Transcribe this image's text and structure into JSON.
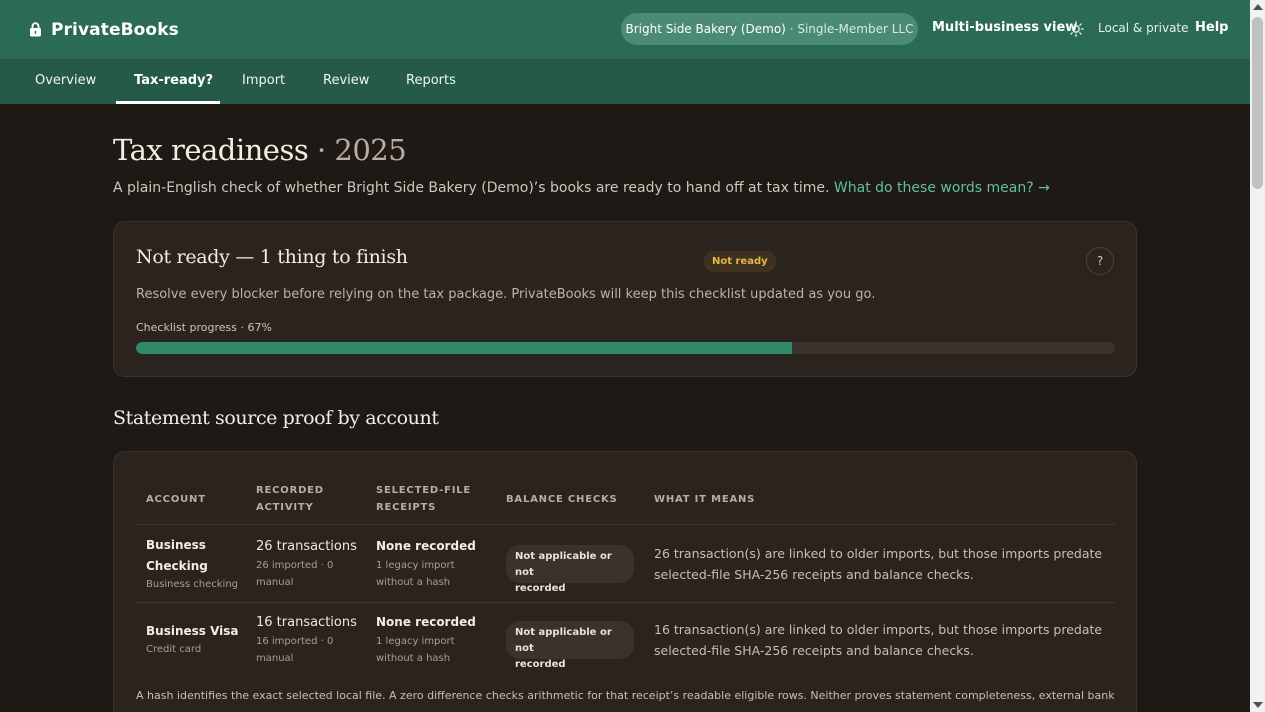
{
  "app": {
    "brand": "PrivateBooks",
    "business_name": "Bright Side Bakery (Demo)",
    "business_type": "· Single-Member LLC",
    "multi_business": "Multi-business view",
    "privacy": "Local & private",
    "help": "Help"
  },
  "nav": {
    "tabs": [
      {
        "label": "Overview"
      },
      {
        "label": "Tax-ready?"
      },
      {
        "label": "Import"
      },
      {
        "label": "Review"
      },
      {
        "label": "Reports"
      }
    ],
    "active": "Tax-ready?"
  },
  "page": {
    "title": "Tax readiness",
    "year": "· 2025",
    "intro": "A plain-English check of whether Bright Side Bakery (Demo)’s books are ready to hand off at tax time.",
    "intro_link": "What do these words mean? →"
  },
  "status": {
    "title": "Not ready — 1 thing to finish",
    "badge": "Not ready",
    "help_button": "?",
    "description": "Resolve every blocker before relying on the tax package. PrivateBooks will keep this checklist updated as you go.",
    "progress_label": "Checklist progress · 67%",
    "progress_fraction": 0.67
  },
  "proof": {
    "title": "Statement source proof by account",
    "columns": {
      "account": "ACCOUNT",
      "activity_1": "RECORDED",
      "activity_2": "ACTIVITY",
      "receipts_1": "SELECTED-FILE",
      "receipts_2": "RECEIPTS",
      "balance": "BALANCE CHECKS",
      "means": "WHAT IT MEANS"
    },
    "rows": [
      {
        "name_1": "Business",
        "name_2": "Checking",
        "type": "Business checking",
        "activity": "26 transactions",
        "activity_sub_1": "26 imported · 0",
        "activity_sub_2": "manual",
        "receipts": "None recorded",
        "receipts_sub_1": "1 legacy import",
        "receipts_sub_2": "without a hash",
        "balance_1": "Not applicable or not",
        "balance_2": "recorded",
        "means_1": "26 transaction(s) are linked to older imports, but those imports predate",
        "means_2": "selected-file SHA-256 receipts and balance checks."
      },
      {
        "name_1": "Business Visa",
        "type": "Credit card",
        "activity": "16 transactions",
        "activity_sub_1": "16 imported · 0",
        "activity_sub_2": "manual",
        "receipts": "None recorded",
        "receipts_sub_1": "1 legacy import",
        "receipts_sub_2": "without a hash",
        "balance_1": "Not applicable or not",
        "balance_2": "recorded",
        "means_1": "16 transaction(s) are linked to older imports, but those imports predate",
        "means_2": "selected-file SHA-256 receipts and balance checks."
      }
    ],
    "footnote": "A hash identifies the exact selected local file. A zero difference checks arithmetic for that receipt’s readable eligible rows. Neither proves statement completeness, external bank"
  }
}
